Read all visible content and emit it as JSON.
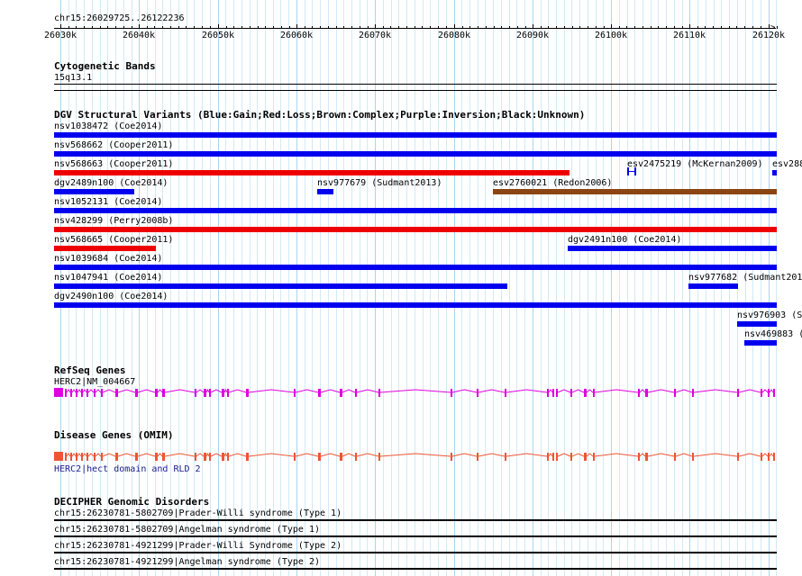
{
  "window": {
    "position_label": "chr15:26029725..26122236"
  },
  "ruler": {
    "ticks": [
      "26030k",
      "26040k",
      "26050k",
      "26060k",
      "26070k",
      "26080k",
      "26090k",
      "26100k",
      "26110k",
      "26120k"
    ]
  },
  "colors": {
    "gain": "#0000ee",
    "loss": "#ee0000",
    "complex": "#8b4513",
    "refseq": "#dd00dd",
    "omim": "#ee5533",
    "gridline": "#a9d6f0"
  },
  "tracks": {
    "cytobands": {
      "title": "Cytogenetic Bands",
      "band_label": "15q13.1"
    },
    "dgv": {
      "title": "DGV Structural Variants (Blue:Gain;Red:Loss;Brown:Complex;Purple:Inversion;Black:Unknown)",
      "features": [
        {
          "label": "nsv1038472 (Coe2014)",
          "type": "gain"
        },
        {
          "label": "nsv568662 (Cooper2011)",
          "type": "gain"
        },
        {
          "label": "nsv568663 (Cooper2011)",
          "type": "loss"
        },
        {
          "label": "esv2475219 (McKernan2009)",
          "type": "gain"
        },
        {
          "label": "esv288",
          "type": "gain"
        },
        {
          "label": "dgv2489n100 (Coe2014)",
          "type": "gain"
        },
        {
          "label": "nsv977679 (Sudmant2013)",
          "type": "gain"
        },
        {
          "label": "esv2760021 (Redon2006)",
          "type": "complex"
        },
        {
          "label": "nsv1052131 (Coe2014)",
          "type": "gain"
        },
        {
          "label": "nsv428299 (Perry2008b)",
          "type": "loss"
        },
        {
          "label": "nsv568665 (Cooper2011)",
          "type": "loss"
        },
        {
          "label": "dgv2491n100 (Coe2014)",
          "type": "gain"
        },
        {
          "label": "nsv1039684 (Coe2014)",
          "type": "gain"
        },
        {
          "label": "nsv1047941 (Coe2014)",
          "type": "gain"
        },
        {
          "label": "nsv977682 (Sudmant201",
          "type": "gain"
        },
        {
          "label": "dgv2490n100 (Coe2014)",
          "type": "gain"
        },
        {
          "label": "nsv976903 (S",
          "type": "gain"
        },
        {
          "label": "nsv469883 (",
          "type": "gain"
        }
      ]
    },
    "refseq": {
      "title": "RefSeq Genes",
      "gene_label": "HERC2|NM_004667"
    },
    "omim": {
      "title": "Disease Genes (OMIM)",
      "gene_label": "HERC2|hect domain and RLD 2"
    },
    "decipher": {
      "title": "DECIPHER Genomic Disorders",
      "items": [
        "chr15:26230781-5802709|Prader-Willi syndrome (Type 1)",
        "chr15:26230781-5802709|Angelman syndrome (Type 1)",
        "chr15:26230781-4921299|Prader-Willi Syndrome (Type 2)",
        "chr15:26230781-4921299|Angelman syndrome (Type 2)"
      ]
    }
  }
}
